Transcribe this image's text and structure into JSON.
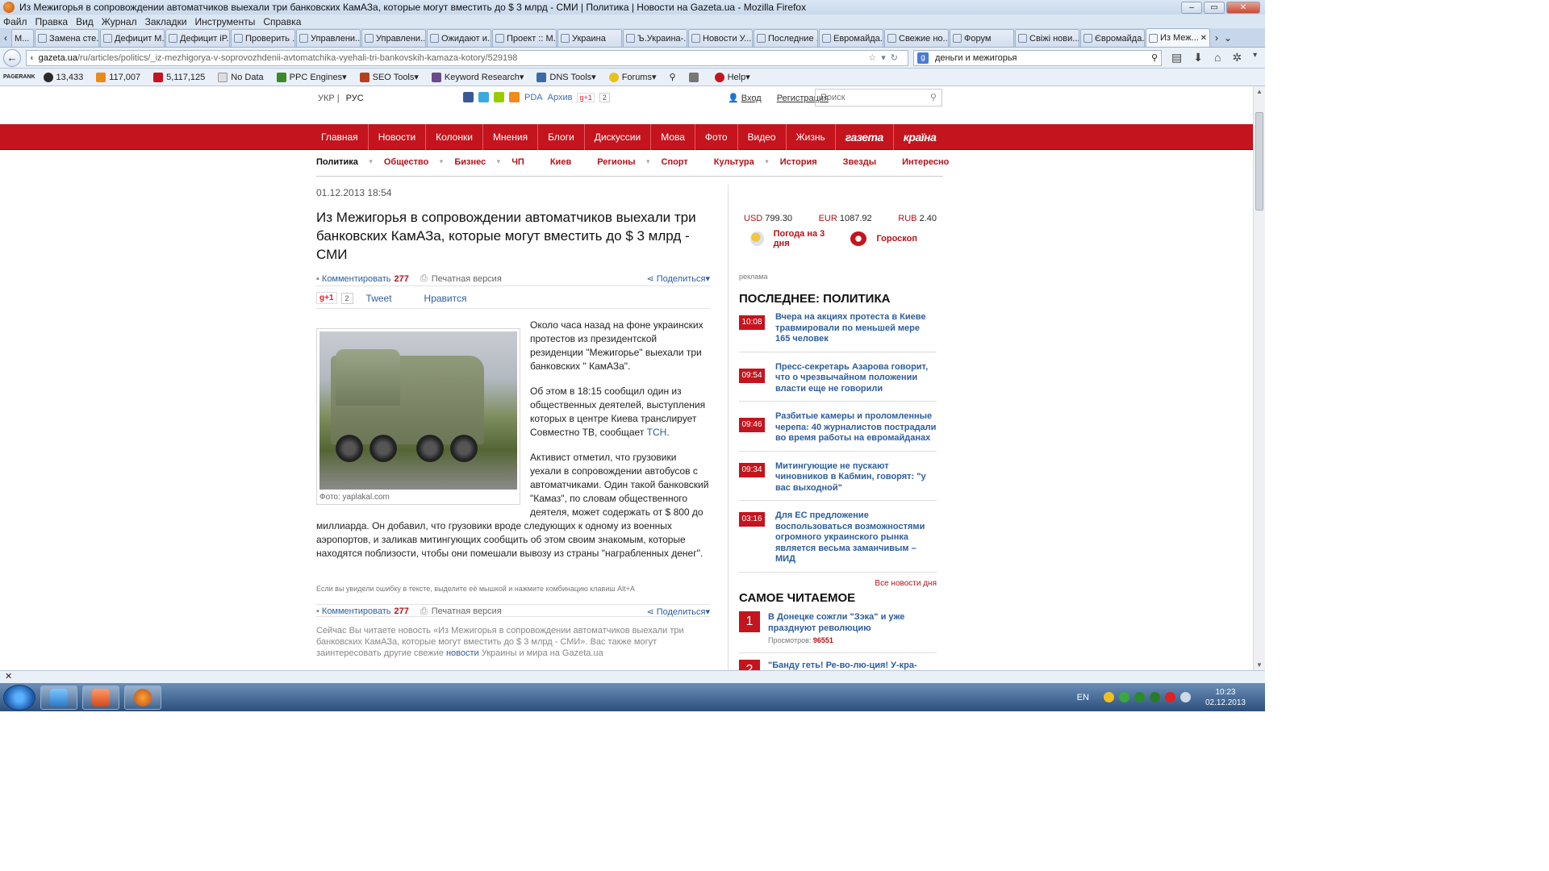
{
  "window": {
    "title": "Из Межигорья в сопровождении автоматчиков выехали три банковских КамАЗа, которые могут вместить до $ 3 млрд - СМИ | Политика | Новости на Gazeta.ua - Mozilla Firefox",
    "min": "–",
    "max": "▭",
    "close": "✕"
  },
  "menu": [
    "Файл",
    "Правка",
    "Вид",
    "Журнал",
    "Закладки",
    "Инструменты",
    "Справка"
  ],
  "tabs": [
    {
      "label": "М..."
    },
    {
      "label": "Замена сте..."
    },
    {
      "label": "Дефицит М..."
    },
    {
      "label": "Дефицит iP..."
    },
    {
      "label": "Проверить ..."
    },
    {
      "label": "Управлени..."
    },
    {
      "label": "Управлени..."
    },
    {
      "label": "Ожидают и..."
    },
    {
      "label": "Проект :: М..."
    },
    {
      "label": "Украина"
    },
    {
      "label": "Ъ.Украина-..."
    },
    {
      "label": "Новости У..."
    },
    {
      "label": "Последние ..."
    },
    {
      "label": "Евромайда..."
    },
    {
      "label": "Свежие но..."
    },
    {
      "label": "Форум"
    },
    {
      "label": "Свіжі нови..."
    },
    {
      "label": "Євромайда..."
    },
    {
      "label": "Из Меж..."
    }
  ],
  "nav": {
    "url_host": "gazeta.ua",
    "url_path": "/ru/articles/politics/_iz-mezhigorya-v-soprovozhdenii-avtomatchika-vyehali-tri-bankovskih-kamaza-kotory/529198",
    "search_value": "деньги и межигорья"
  },
  "bookmarks": [
    {
      "label": "13,433",
      "color": "#2a2a2a"
    },
    {
      "label": "117,007",
      "color": "#e88a1a"
    },
    {
      "label": "5,117,125",
      "color": "#c4141d"
    },
    {
      "label": "No Data",
      "color": "#cccccc"
    },
    {
      "label": "PPC Engines",
      "color": "#3a8a2a"
    },
    {
      "label": "SEO Tools",
      "color": "#b54020"
    },
    {
      "label": "Keyword Research",
      "color": "#6a4a8a"
    },
    {
      "label": "DNS Tools",
      "color": "#3a6aaa"
    },
    {
      "label": "Forums",
      "color": "#e8c21a"
    },
    {
      "label": "Help",
      "color": "#c4141d"
    }
  ],
  "pagerank": "PAGERANK",
  "site": {
    "lang_uk": "УКР",
    "lang_ru": "РУС",
    "pda": "PDA",
    "archive": "Архив",
    "gplus": "g+1",
    "gplus_count": "2",
    "login": "Вход",
    "register": "Регистрация",
    "search_placeholder": "Поиск",
    "mainnav": [
      "Главная",
      "Новости",
      "Колонки",
      "Мнения",
      "Блоги",
      "Дискуссии",
      "Мова",
      "Фото",
      "Видео",
      "Жизнь"
    ],
    "logo1": "газета",
    "logo2": "країна",
    "subnav": [
      "Политика",
      "Общество",
      "Бизнес",
      "ЧП",
      "Киев",
      "Регионы",
      "Спорт",
      "Культура",
      "История",
      "Звезды",
      "Интересно"
    ]
  },
  "article": {
    "date": "01.12.2013 18:54",
    "title": "Из Межигорья в сопровождении автоматчиков выехали три банковских КамАЗа, которые могут вместить до $ 3 млрд - СМИ",
    "comment": "Комментировать",
    "comment_count": "277",
    "print": "Печатная версия",
    "share": "Поделиться",
    "gplus": "g+1",
    "gplus_count": "2",
    "tweet": "Tweet",
    "like": "Нравится",
    "photo_caption": "Фото: yaplakal.com",
    "p1": "Около часа назад на фоне украинских протестов из президентской резиденции \"Межигорье\" выехали три банковских \" КамАЗа\".",
    "p2_pre": "Об этом в 18:15 сообщил один из общественных деятелей, выступления которых в центре Киева транслирует Совместно ТВ, сообщает ",
    "p2_link": "ТСН",
    "p2_post": ".",
    "p3": "Активист отметил, что грузовики уехали в сопровождении автобусов с автоматчиками. Один такой банковский \"Камаз\", по словам общественного деятеля, может содержать от $ 800 до миллиарда. Он добавил, что грузовики вроде следующих к одному из военных аэропортов, и заликав митингующих сообщить об этом своим знакомым, которые находятся поблизости, чтобы они помешали вывозу из страны \"награбленных денег\".",
    "error_note": "Если вы увидели ошибку в тексте, выделите её мышкой и нажмите комбинацию клавиш Alt+A",
    "reading_pre": "Сейчас Вы читаете новость «Из Межигорья в сопровождении автоматчиков выехали три банковских КамАЗа, которые могут вместить до $ 3 млрд - СМИ». Вас также могут заинтересовать другие свежие ",
    "reading_link": "новости",
    "reading_post": " Украины и мира на Gazeta.ua"
  },
  "sidebar": {
    "usd_label": "USD",
    "usd": "799.30",
    "eur_label": "EUR",
    "eur": "1087.92",
    "rub_label": "RUB",
    "rub": "2.40",
    "weather": "Погода на 3 дня",
    "horoscope": "Гороскоп",
    "ads": "реклама",
    "latest_title": "ПОСЛЕДНЕЕ: ПОЛИТИКА",
    "latest": [
      {
        "time": "10:08",
        "text": "Вчера на акциях протеста в Киеве травмировали по меньшей мере 165 человек"
      },
      {
        "time": "09:54",
        "text": "Пресс-секретарь Азарова говорит, что о чрезвычайном положении власти еще не говорили"
      },
      {
        "time": "09:46",
        "text": "Разбитые камеры и проломленные черепа: 40 журналистов пострадали во время работы на евромайданах"
      },
      {
        "time": "09:34",
        "text": "Митингующие не пускают чиновников в Кабмин, говорят: \"у вас выходной\""
      },
      {
        "time": "03:16",
        "text": "Для ЕС предложение воспользоваться возможностями огромного украинского рынка является весьма заманчивым – МИД"
      }
    ],
    "all_news": "Все новости дня",
    "popular_title": "САМОЕ ЧИТАЕМОЕ",
    "popular": [
      {
        "rank": "1",
        "text": "В Донецке сожгли \"Зэка\" и уже празднуют революцию",
        "views_label": "Просмотров:",
        "views": "96551"
      },
      {
        "rank": "2",
        "text": "\"Банду геть! Ре-во-лю-ция! У-кра-",
        "views_label": "",
        "views": ""
      }
    ]
  },
  "status": "✕",
  "taskbar": {
    "lang": "EN",
    "time": "10:23",
    "date": "02.12.2013"
  }
}
